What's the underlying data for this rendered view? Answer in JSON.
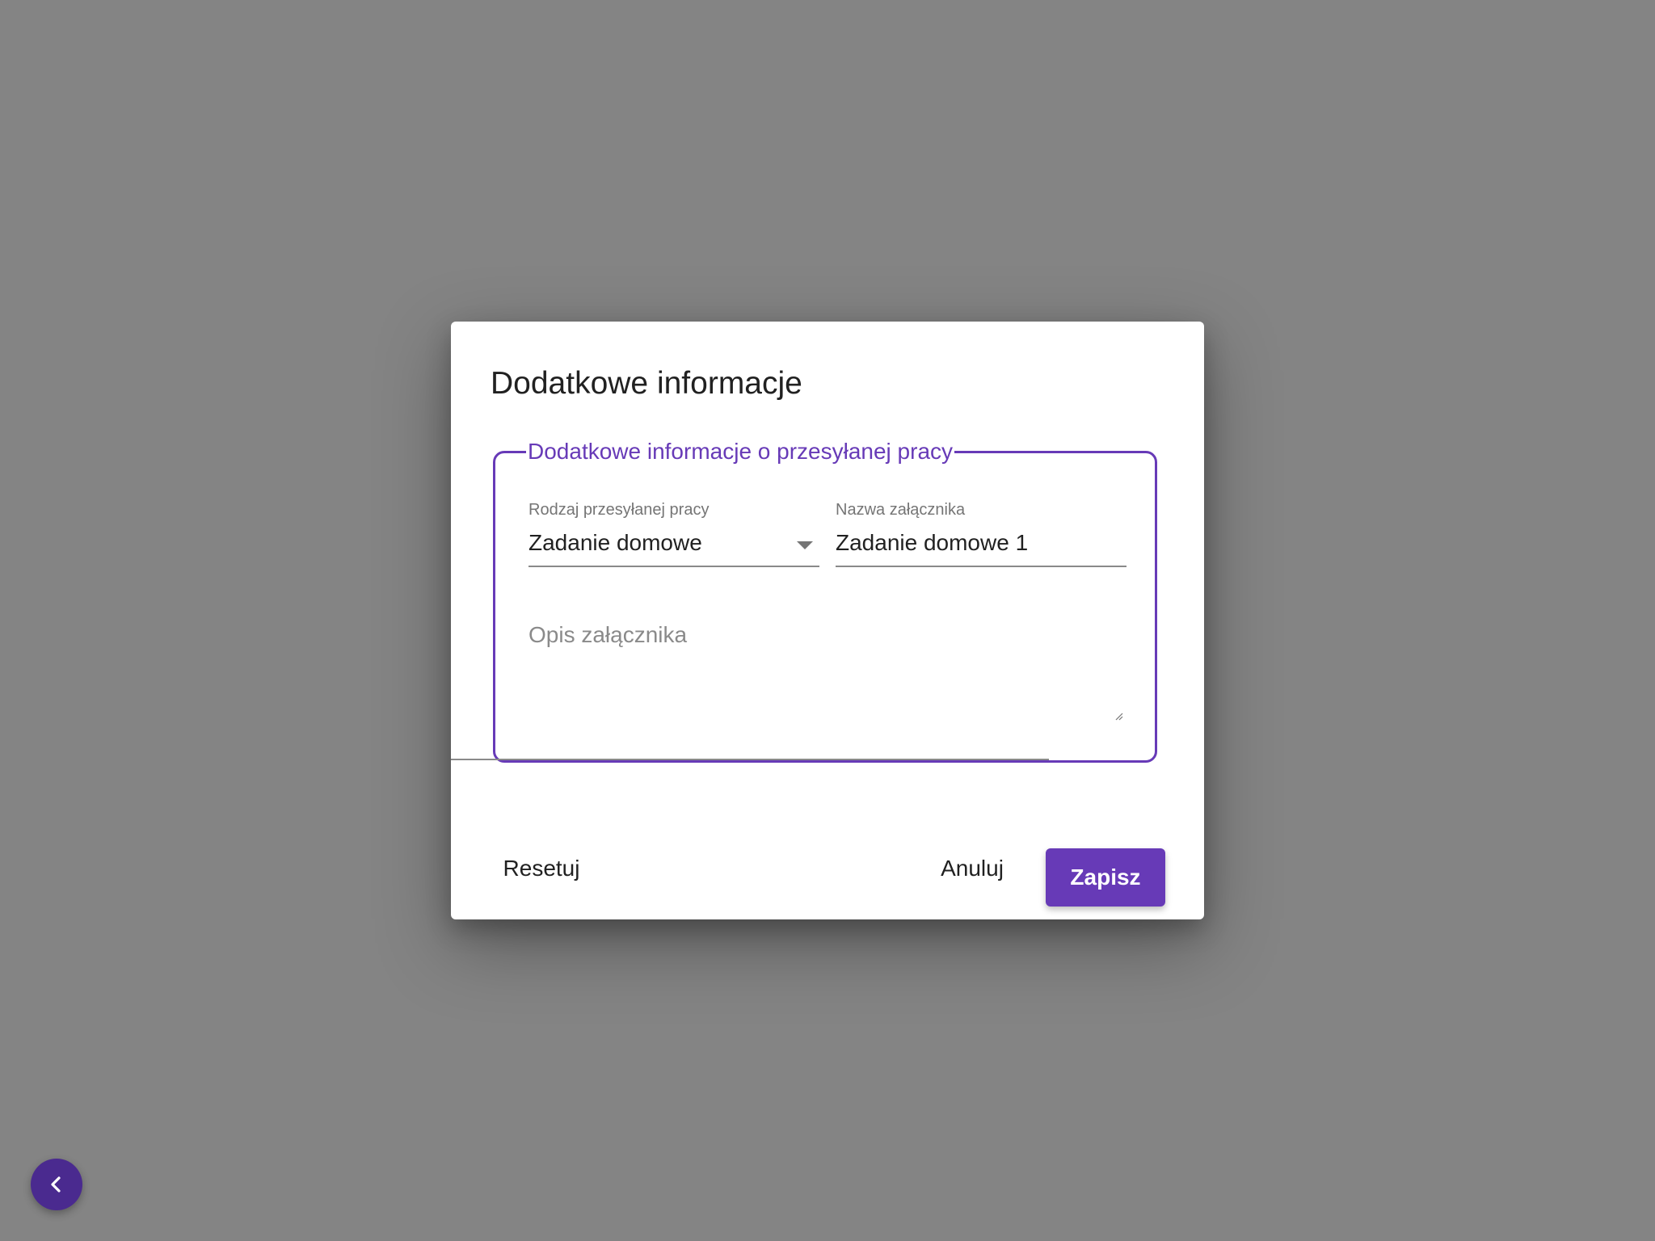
{
  "colors": {
    "accent": "#673ab7",
    "backdrop": "#848484",
    "text_primary": "#212121",
    "text_secondary": "#757575",
    "fab": "#4a2a8f"
  },
  "dialog": {
    "title": "Dodatkowe informacje",
    "group_legend": "Dodatkowe informacje o przesyłanej pracy",
    "work_type": {
      "label": "Rodzaj przesyłanej pracy",
      "value": "Zadanie domowe",
      "icon": "caret-down-icon"
    },
    "attachment_name": {
      "label": "Nazwa załącznika",
      "value": "Zadanie domowe 1"
    },
    "attachment_description": {
      "placeholder": "Opis załącznika",
      "value": ""
    },
    "buttons": {
      "reset": "Resetuj",
      "cancel": "Anuluj",
      "save": "Zapisz"
    }
  },
  "fab": {
    "icon": "chevron-left-icon"
  }
}
